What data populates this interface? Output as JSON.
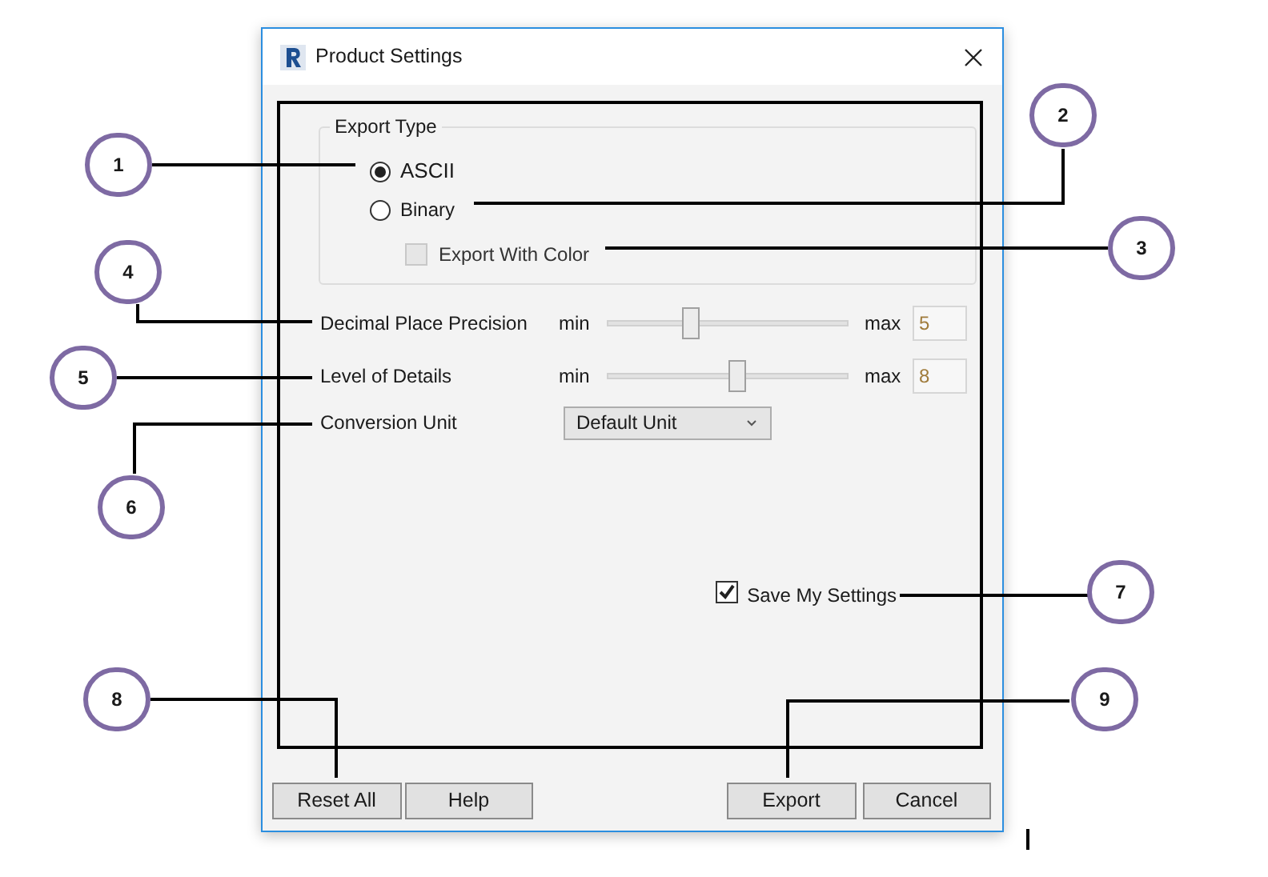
{
  "window": {
    "title": "Product Settings"
  },
  "export_type": {
    "label": "Export Type",
    "options": [
      {
        "label": "ASCII",
        "selected": true
      },
      {
        "label": "Binary",
        "selected": false
      }
    ],
    "export_with_color": {
      "label": "Export With Color",
      "checked": false,
      "disabled": true
    }
  },
  "sliders": [
    {
      "label": "Decimal Place Precision",
      "min_label": "min",
      "max_label": "max",
      "level": 0.33,
      "value": "5"
    },
    {
      "label": "Level of Details",
      "min_label": "min",
      "max_label": "max",
      "level": 0.54,
      "value": "8"
    }
  ],
  "conversion_unit": {
    "label": "Conversion Unit",
    "value": "Default Unit"
  },
  "save_settings": {
    "label": "Save My Settings",
    "checked": true
  },
  "buttons": [
    "Reset All",
    "Help",
    "Export",
    "Cancel"
  ],
  "callouts": [
    "1",
    "2",
    "3",
    "4",
    "5",
    "6",
    "7",
    "8",
    "9"
  ]
}
